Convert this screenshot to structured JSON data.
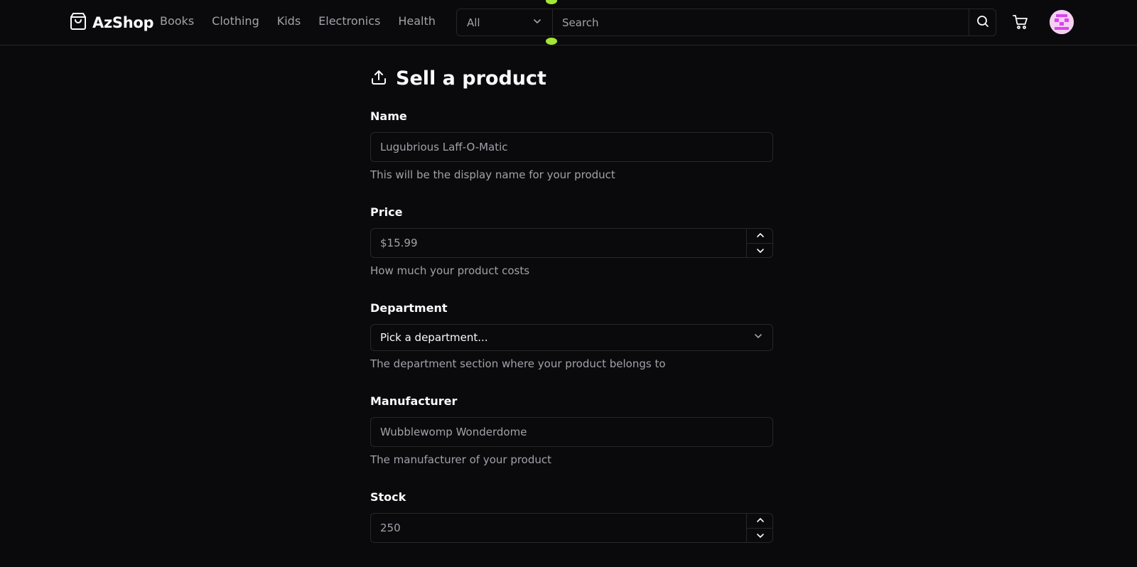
{
  "header": {
    "brand": "AzShop",
    "nav": [
      "Books",
      "Clothing",
      "Kids",
      "Electronics",
      "Health"
    ],
    "search": {
      "department": "All",
      "placeholder": "Search"
    }
  },
  "form": {
    "title": "Sell a product",
    "fields": {
      "name": {
        "label": "Name",
        "value": "Lugubrious Laff-O-Matic",
        "help": "This will be the display name for your product"
      },
      "price": {
        "label": "Price",
        "value": "$15.99",
        "help": "How much your product costs"
      },
      "department": {
        "label": "Department",
        "value": "Pick a department...",
        "help": "The department section where your product belongs to"
      },
      "manufacturer": {
        "label": "Manufacturer",
        "value": "Wubblewomp Wonderdome",
        "help": "The manufacturer of your product"
      },
      "stock": {
        "label": "Stock",
        "value": "250"
      }
    }
  },
  "colors": {
    "background": "#0a0a0c",
    "border": "#27272a",
    "muted_text": "#a1a1aa",
    "accent_handle": "#a3e635"
  }
}
